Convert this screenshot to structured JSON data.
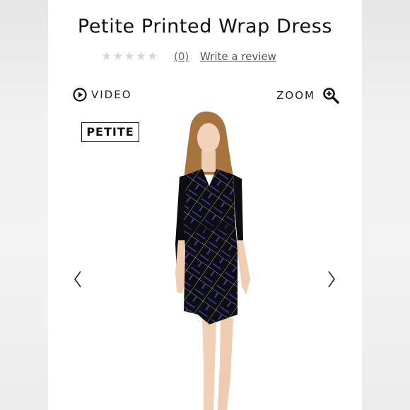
{
  "product": {
    "title": "Petite Printed Wrap Dress",
    "rating": {
      "stars_filled": 0,
      "stars_total": 5,
      "count_label": "(0)",
      "write_review_label": "Write a review"
    },
    "media": {
      "video_label": "VIDEO",
      "zoom_label": "ZOOM",
      "badge": "PETITE",
      "prev_icon": "chevron-left-icon",
      "next_icon": "chevron-right-icon"
    }
  },
  "colors": {
    "background": "#ffffff",
    "text": "#111111",
    "star_empty": "#d8d8d8",
    "dress_base": "#0d0d12",
    "dress_pattern": "#3b3f9e"
  }
}
